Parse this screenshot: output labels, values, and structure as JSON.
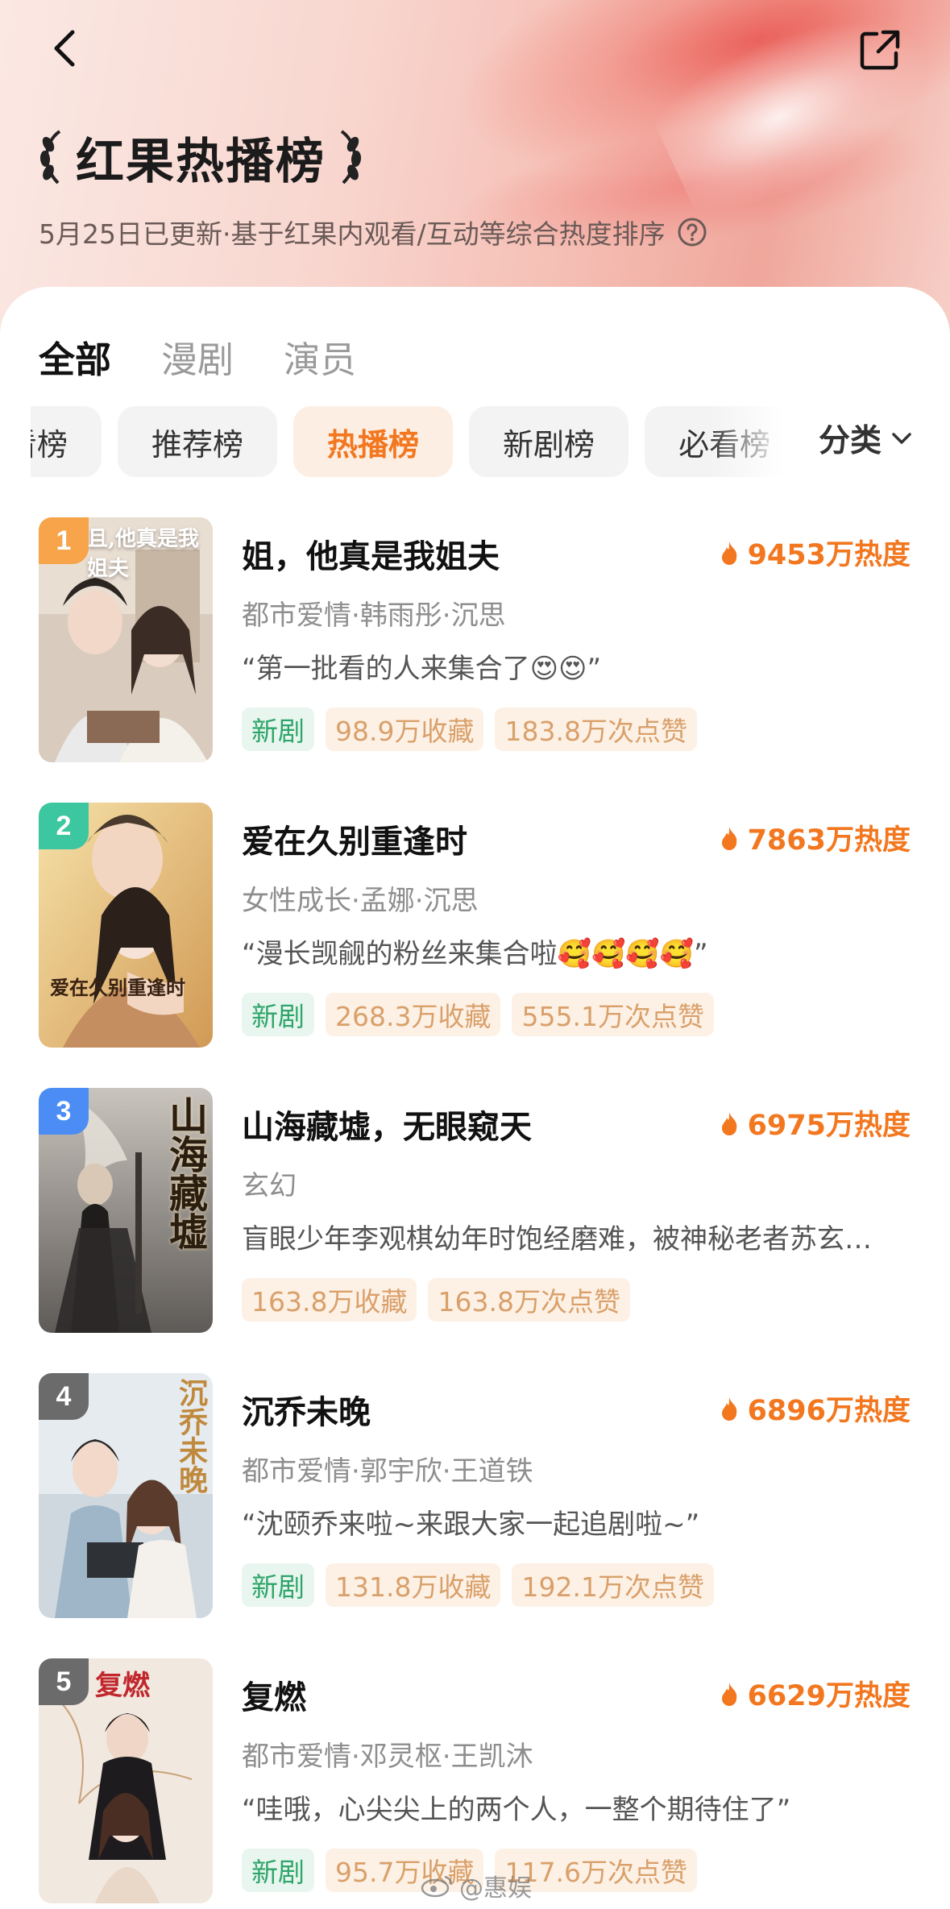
{
  "header": {
    "title": "红果热播榜",
    "subtitle": "5月25日已更新·基于红果内观看/互动等综合热度排序",
    "icons": {
      "back": "chevron-left-icon",
      "share": "share-icon",
      "help": "question-circle-icon"
    }
  },
  "tabs": [
    {
      "label": "全部",
      "active": true
    },
    {
      "label": "漫剧",
      "active": false
    },
    {
      "label": "演员",
      "active": false
    }
  ],
  "chips": [
    {
      "label": "必看榜",
      "active": false
    },
    {
      "label": "推荐榜",
      "active": false
    },
    {
      "label": "热播榜",
      "active": true
    },
    {
      "label": "新剧榜",
      "active": false
    },
    {
      "label": "必看榜",
      "active": false
    }
  ],
  "category": {
    "label": "分类",
    "icon": "chevron-down-icon"
  },
  "colors": {
    "accent": "#f2771f",
    "new_tag": "#2fa56a",
    "stat_tag": "#d9a06a"
  },
  "list": [
    {
      "rank": "1",
      "rank_color": "#f7a44a",
      "title": "姐，他真是我姐夫",
      "heat": "9453万热度",
      "meta": "都市爱情·韩雨彤·沉思",
      "quote": "“第一批看的人来集合了😍😍”",
      "tags": {
        "new": "新剧",
        "fav": "98.9万收藏",
        "like": "183.8万次点赞"
      },
      "cover_text": "且,他真是我姐夫"
    },
    {
      "rank": "2",
      "rank_color": "#3cc7a0",
      "title": "爱在久别重逢时",
      "heat": "7863万热度",
      "meta": "女性成长·孟娜·沉思",
      "quote": "“漫长觊觎的粉丝来集合啦🥰🥰🥰🥰”",
      "tags": {
        "new": "新剧",
        "fav": "268.3万收藏",
        "like": "555.1万次点赞"
      },
      "cover_text": "爱在久别重逢时"
    },
    {
      "rank": "3",
      "rank_color": "#4c8df5",
      "title": "山海藏墟，无眼窥天",
      "heat": "6975万热度",
      "meta": "玄幻",
      "quote": "盲眼少年李观棋幼年时饱经磨难，被神秘老者苏玄…",
      "tags": {
        "fav": "163.8万收藏",
        "like": "163.8万次点赞"
      },
      "cover_text": "山海藏墟"
    },
    {
      "rank": "4",
      "rank_color": "#6b6b6b",
      "title": "沉乔未晚",
      "heat": "6896万热度",
      "meta": "都市爱情·郭宇欣·王道铁",
      "quote": "“沈颐乔来啦~来跟大家一起追剧啦~”",
      "tags": {
        "new": "新剧",
        "fav": "131.8万收藏",
        "like": "192.1万次点赞"
      },
      "cover_text": "沉乔未晚"
    },
    {
      "rank": "5",
      "rank_color": "#6b6b6b",
      "title": "复燃",
      "heat": "6629万热度",
      "meta": "都市爱情·邓灵枢·王凯沐",
      "quote": "“哇哦，心尖尖上的两个人，一整个期待住了”",
      "tags": {
        "new": "新剧",
        "fav": "95.7万收藏",
        "like": "117.6万次点赞"
      },
      "cover_text": "复燃"
    }
  ],
  "watermark": "@惠娱"
}
